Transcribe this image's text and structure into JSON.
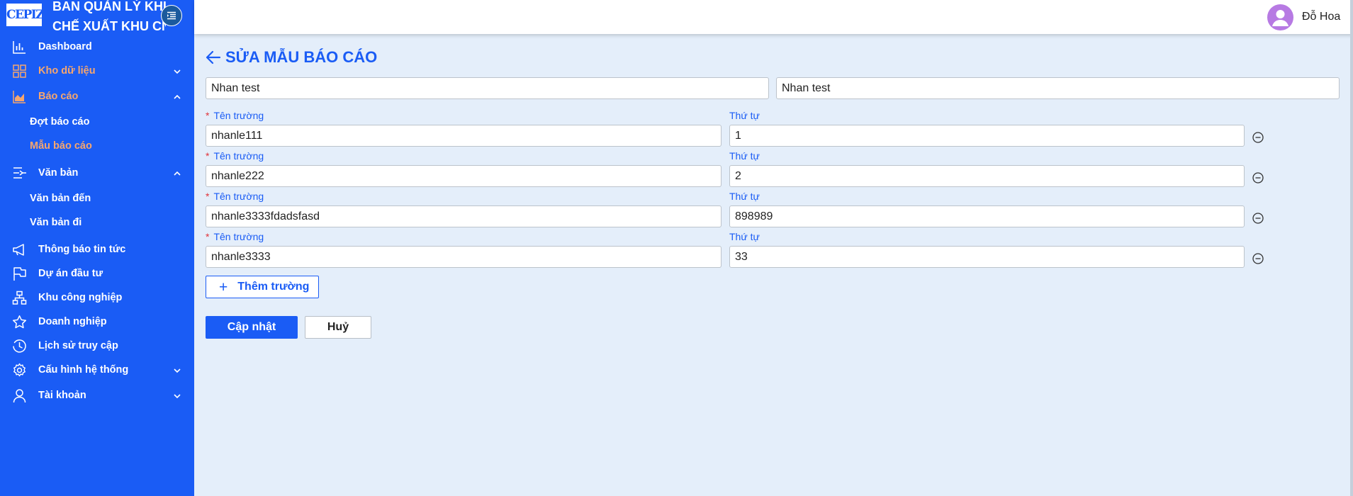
{
  "sidebar": {
    "logo": "CEPIZA",
    "brand_line1": "BAN QUẢN LÝ KHU",
    "brand_line2": "CHẾ XUẤT KHU CN",
    "items": [
      {
        "label": "Dashboard",
        "icon": "bar-chart-icon"
      },
      {
        "label": "Kho dữ liệu",
        "icon": "grid-icon"
      },
      {
        "label": "Báo cáo",
        "icon": "area-chart-icon"
      },
      {
        "label": "Đợt báo cáo"
      },
      {
        "label": "Mẫu báo cáo"
      },
      {
        "label": "Văn bản",
        "icon": "document-export-icon"
      },
      {
        "label": "Văn bản đến"
      },
      {
        "label": "Văn bản đi"
      },
      {
        "label": "Thông báo tin tức",
        "icon": "megaphone-icon"
      },
      {
        "label": "Dự án đầu tư",
        "icon": "flag-icon"
      },
      {
        "label": "Khu công nghiệp",
        "icon": "cluster-icon"
      },
      {
        "label": "Doanh nghiệp",
        "icon": "star-icon"
      },
      {
        "label": "Lịch sử truy cập",
        "icon": "clock-icon"
      },
      {
        "label": "Cấu hình hệ thống",
        "icon": "gear-icon"
      },
      {
        "label": "Tài khoản",
        "icon": "user-icon"
      }
    ]
  },
  "header": {
    "username": "Đỗ Hoa"
  },
  "page": {
    "title": "SỬA MẪU BÁO CÁO",
    "name_value": "Nhan test",
    "code_value": "Nhan test"
  },
  "form": {
    "field_label": "Tên trường",
    "order_label": "Thứ tự",
    "rows": [
      {
        "name": "nhanle111",
        "order": "1"
      },
      {
        "name": "nhanle222",
        "order": "2"
      },
      {
        "name": "nhanle3333fdadsfasd",
        "order": "898989"
      },
      {
        "name": "nhanle3333",
        "order": "33"
      }
    ],
    "add_label": "Thêm trường",
    "update_label": "Cập nhật",
    "cancel_label": "Huỷ"
  },
  "colors": {
    "primary": "#1a5cf5",
    "active_menu": "#f6a66e",
    "background": "#e4eefa",
    "required": "#e0333a"
  }
}
